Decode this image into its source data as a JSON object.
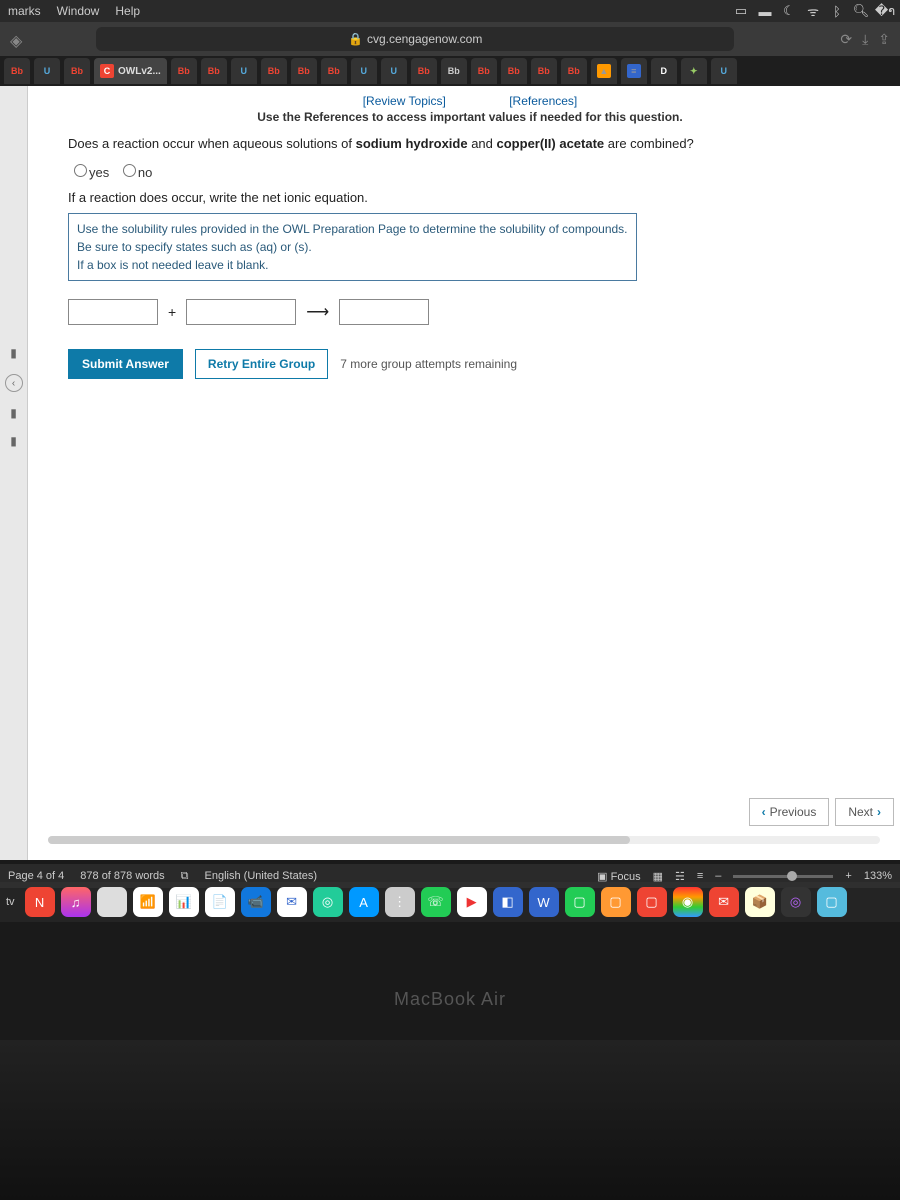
{
  "menubar": {
    "items": [
      "marks",
      "Window",
      "Help"
    ]
  },
  "browser": {
    "url_host": "cvg.cengagenow.com",
    "active_tab_label": "OWLv2...",
    "active_tab_favicon": "C"
  },
  "tab_favicons": [
    "Bb",
    "U",
    "Bb",
    "",
    "Bb",
    "Bb",
    "U",
    "Bb",
    "Bb",
    "Bb",
    "U",
    "U",
    "Bb",
    "Bb",
    "Bb",
    "Bb",
    "Bb",
    "Bb",
    "",
    "",
    "D",
    "",
    "U"
  ],
  "owl": {
    "links": {
      "review": "[Review Topics]",
      "references": "[References]"
    },
    "ref_note": "Use the References to access important values if needed for this question.",
    "question_pre": "Does a reaction occur when aqueous solutions of ",
    "reagent1": "sodium hydroxide",
    "mid": " and ",
    "reagent2": "copper(II) acetate",
    "question_post": " are combined?",
    "radio_yes": "yes",
    "radio_no": "no",
    "subq": "If a reaction does occur, write the net ionic equation.",
    "hint_l1": "Use the solubility rules provided in the OWL Preparation Page to determine the solubility of compounds.",
    "hint_l2": "Be sure to specify states such as (aq) or (s).",
    "hint_l3": "If a box is not needed leave it blank.",
    "plus": "+",
    "arrow": "⟶",
    "submit": "Submit Answer",
    "retry": "Retry Entire Group",
    "attempts": "7 more group attempts remaining",
    "prev": "Previous",
    "next": "Next"
  },
  "word_status": {
    "page": "Page 4 of 4",
    "words": "878 of 878 words",
    "lang": "English (United States)",
    "focus": "Focus",
    "zoom_plus": "+",
    "zoom": "133%",
    "minus": "–"
  },
  "macbook": "MacBook Air",
  "tv": "tv"
}
